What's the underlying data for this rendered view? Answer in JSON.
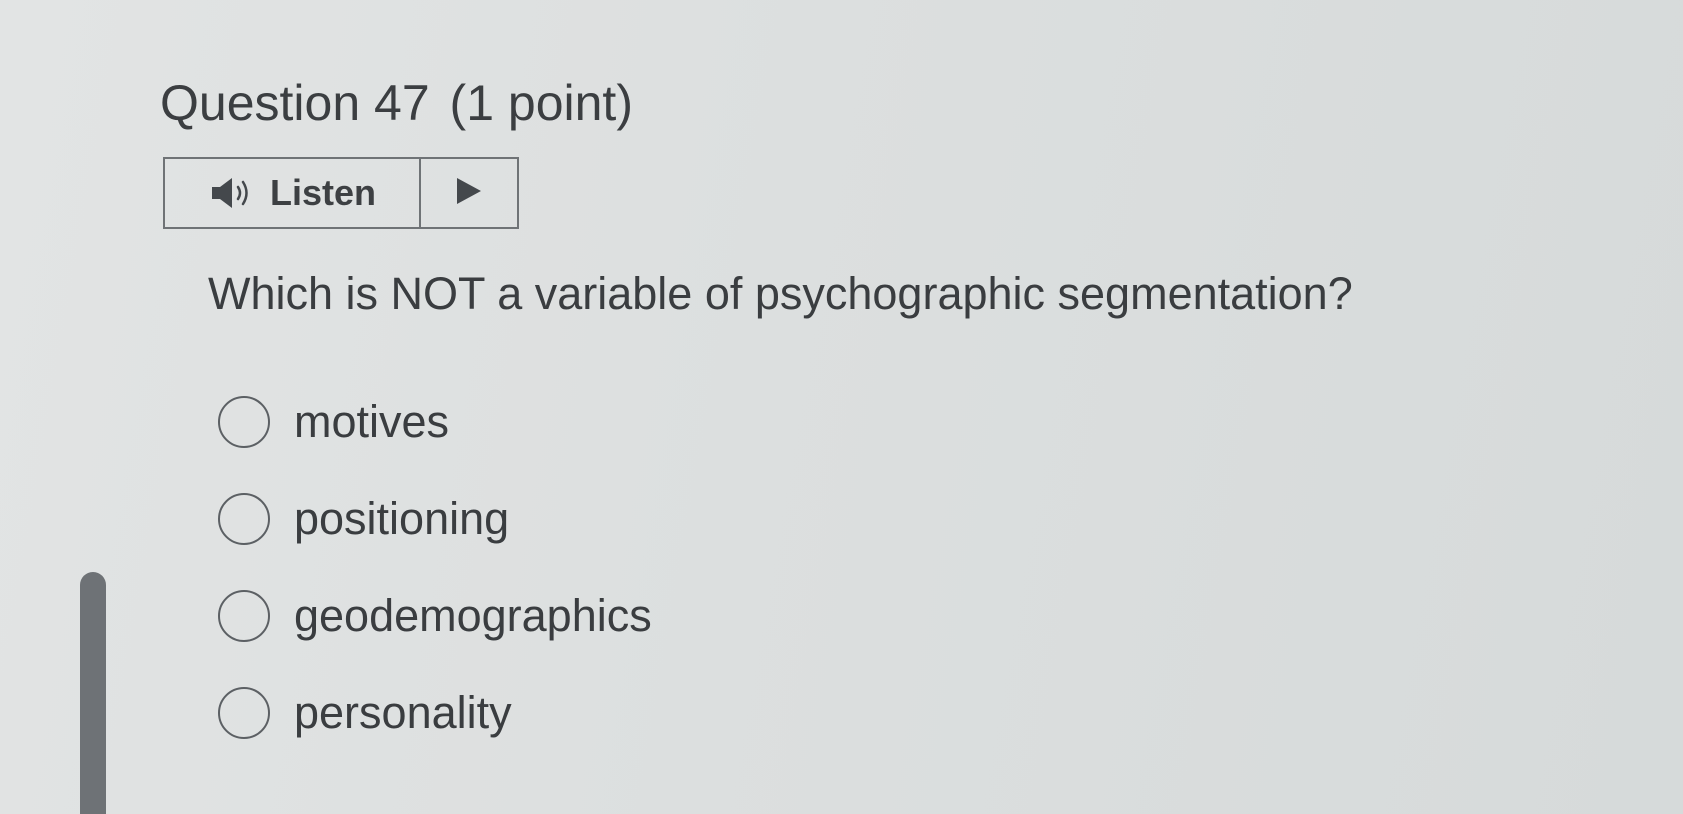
{
  "question": {
    "title": "Question 47",
    "points": "(1 point)",
    "text": "Which is NOT a variable of psychographic segmentation?"
  },
  "listen": {
    "label": "Listen",
    "speaker_icon": "speaker-icon",
    "play_icon": "play-icon"
  },
  "options": [
    {
      "label": "motives"
    },
    {
      "label": "positioning"
    },
    {
      "label": "geodemographics"
    },
    {
      "label": "personality"
    }
  ],
  "colors": {
    "text": "#3a3d40",
    "border": "#6f7376",
    "background": "#dcdfdf"
  }
}
